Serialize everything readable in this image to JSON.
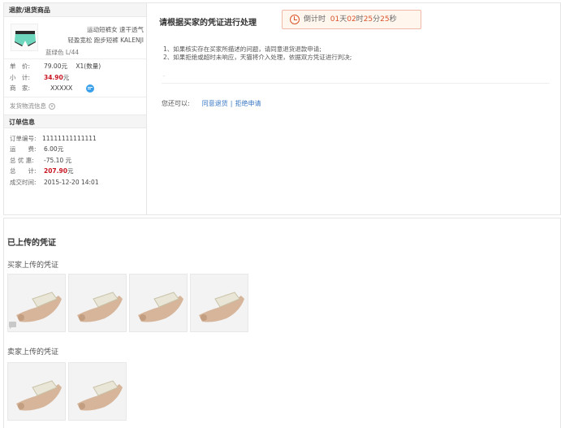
{
  "left_panel": {
    "section_title": "退款/退货商品",
    "product": {
      "title_line1": "运动短裤女 速干透气",
      "title_line2": "轻盈宽松 跑步短裤 KALENJI",
      "color_size": "蓝绿色  L/44"
    },
    "price_label": "单　价:",
    "price_value": "79.00元",
    "quantity": "X1(数量)",
    "subtotal_label": "小　计:",
    "subtotal_value": "34.90",
    "subtotal_unit": "元",
    "merchant_label": "商　家:",
    "merchant_value": "XXXXX",
    "shipping_info": "发货物流信息"
  },
  "order_info": {
    "section_title": "订单信息",
    "order_no_label": "订单编号:",
    "order_no": "11111111111111",
    "freight_label": "运　　费:",
    "freight": "6.00元",
    "discount_label": "总 优 惠:",
    "discount": "-75.10 元",
    "total_label": "总　　计:",
    "total": "207.90",
    "total_unit": "元",
    "deal_time_label": "成交时间:",
    "deal_time": "2015-12-20 14:01"
  },
  "right_panel": {
    "title": "请根据买家的凭证进行处理",
    "countdown": {
      "prefix": "倒计时",
      "days": "01",
      "days_unit": "天",
      "hours": "02",
      "hours_unit": "时",
      "minutes": "25",
      "minutes_unit": "分",
      "seconds": "25",
      "seconds_unit": "秒"
    },
    "note1": "1、如果核实存在买家所描述的问题，请同意退货退款申请;",
    "note2": "2、如果拒绝或超时未响应，天猫将介入处理，依据双方凭证进行判决;",
    "dot": "·",
    "actions_label": "您还可以:",
    "action_agree": "同意退货",
    "action_sep": "|",
    "action_reject": "拒绝申请"
  },
  "evidence": {
    "title": "已上传的凭证",
    "buyer_label": "买家上传的凭证",
    "seller_label": "卖家上传的凭证",
    "buyer_count": 4,
    "seller_count": 2
  },
  "colors": {
    "accent_red": "#c81623",
    "timer_orange": "#d9542a",
    "link_blue": "#3a78c3"
  }
}
